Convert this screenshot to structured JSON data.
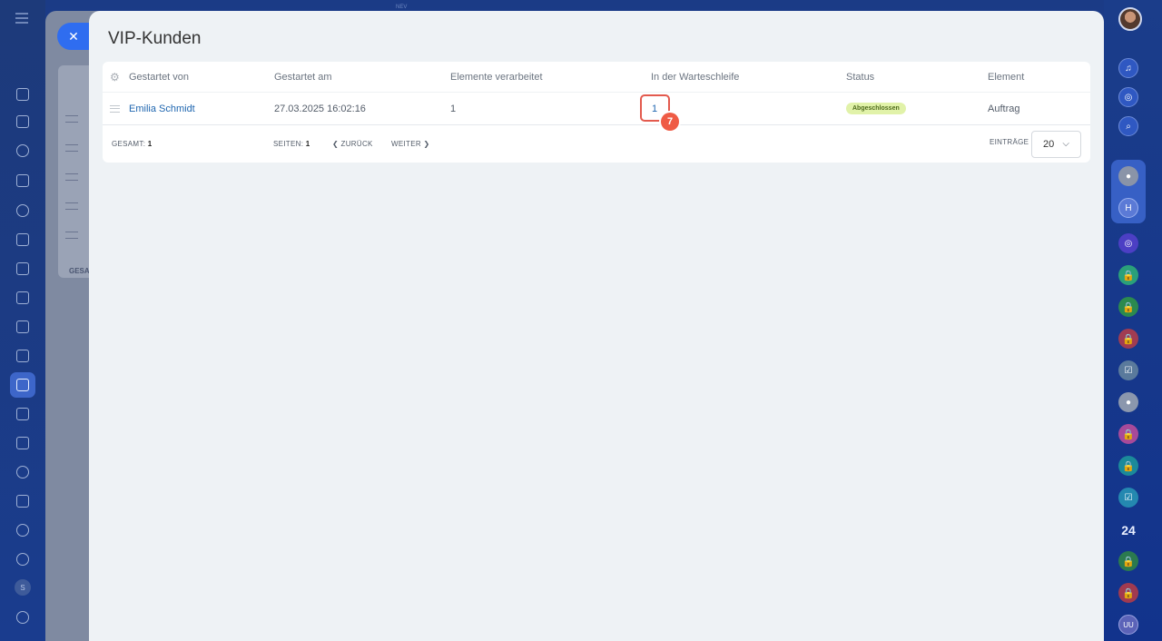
{
  "window": {
    "title": "VIP-Kunden",
    "top_label": "NEV"
  },
  "grid": {
    "columns": [
      "Gestartet von",
      "Gestartet am",
      "Elemente verarbeitet",
      "In der Warteschleife",
      "Status",
      "Element"
    ],
    "rows": [
      {
        "started_by": "Emilia Schmidt",
        "started_at": "27.03.2025 16:02:16",
        "processed": "1",
        "in_queue": "1",
        "status": "Abgeschlossen",
        "element": "Auftrag"
      }
    ]
  },
  "footer": {
    "total_label": "GESAMT:",
    "total_value": "1",
    "pages_label": "SEITEN:",
    "pages_value": "1",
    "back_label": "ZURÜCK",
    "next_label": "WEITER",
    "per_page_label": "EINTRÄGE",
    "per_page_value": "20"
  },
  "annotation": {
    "step_number": "7"
  },
  "background_panel": {
    "total_label": "GESA"
  },
  "left_sidebar": {
    "small_badge": "S"
  },
  "right_sidebar": {
    "counter_label": "24",
    "avatar_initial_1": "H",
    "avatar_initial_2": "UU"
  },
  "colors": {
    "accent": "#2f6df0",
    "link": "#2067b0",
    "status_badge_bg": "#e1f2a9",
    "highlight_border": "#e35a4e",
    "step_badge": "#ef5b45"
  }
}
